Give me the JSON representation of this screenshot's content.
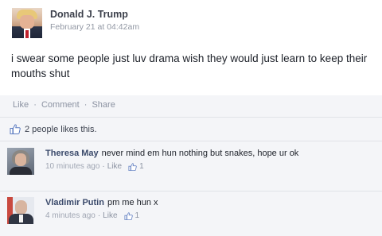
{
  "post": {
    "author": "Donald J. Trump",
    "timestamp": "February 21 at 04:42am",
    "text": "i swear some people just luv drama wish they would just learn to keep their mouths shut"
  },
  "actions": {
    "like": "Like",
    "comment": "Comment",
    "share": "Share",
    "separator": "·"
  },
  "likes_summary": "2 people likes this.",
  "comments": [
    {
      "name": "Theresa May",
      "text": "never mind em hun nothing but snakes, hope ur ok",
      "time": "10 minutes ago",
      "like_label": "Like",
      "like_count": "1"
    },
    {
      "name": "Vladimir Putin",
      "text": "pm me hun x",
      "time": "4 minutes ago",
      "like_label": "Like",
      "like_count": "1"
    }
  ],
  "colors": {
    "name_link": "#3b4a6b",
    "meta": "#9197a3",
    "bar_bg": "#f4f5f8"
  }
}
